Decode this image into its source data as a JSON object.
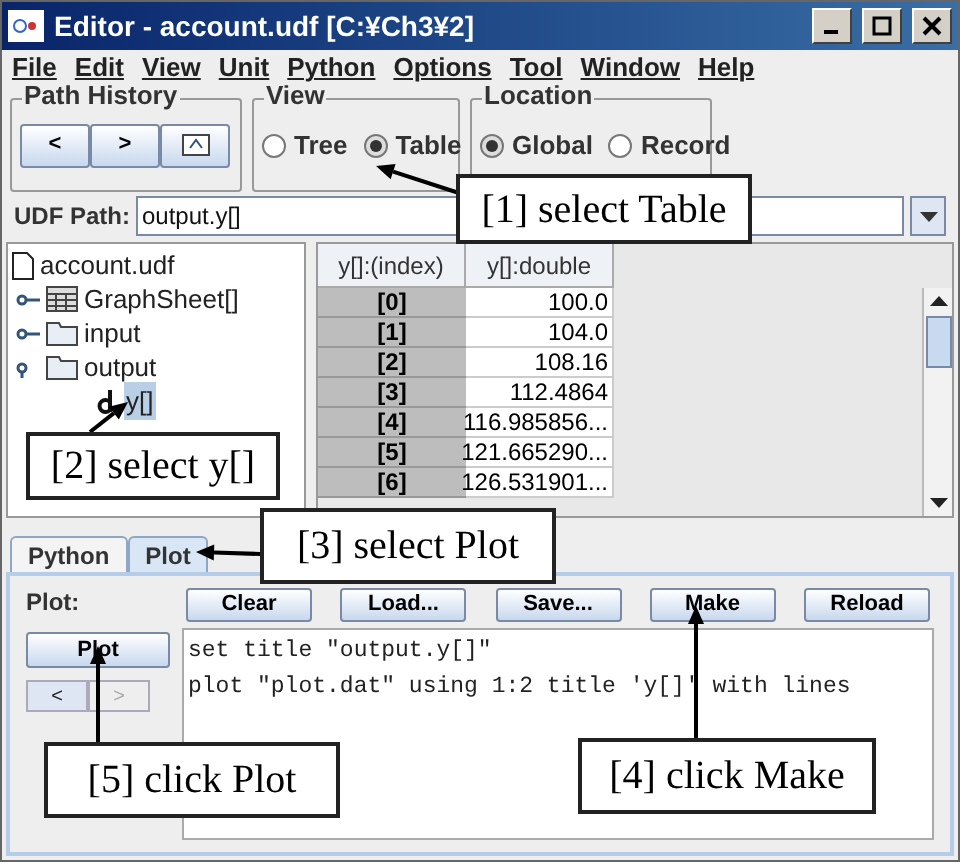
{
  "window": {
    "title": "Editor - account.udf [C:¥Ch3¥2]"
  },
  "menu": [
    "File",
    "Edit",
    "View",
    "Unit",
    "Python",
    "Options",
    "Tool",
    "Window",
    "Help"
  ],
  "path_history": {
    "title": "Path History",
    "buttons": [
      "<",
      ">"
    ]
  },
  "view": {
    "title": "View",
    "options": [
      {
        "label": "Tree",
        "selected": false
      },
      {
        "label": "Table",
        "selected": true
      }
    ]
  },
  "location": {
    "title": "Location",
    "options": [
      {
        "label": "Global",
        "selected": true
      },
      {
        "label": "Record",
        "selected": false
      }
    ]
  },
  "udf_path": {
    "label": "UDF Path:",
    "value": "output.y[]"
  },
  "tree": {
    "label": "account.udf",
    "children": [
      {
        "label": "GraphSheet[]",
        "kind": "table",
        "expanded": false
      },
      {
        "label": "input",
        "kind": "folder",
        "expanded": false
      },
      {
        "label": "output",
        "kind": "folder",
        "expanded": true,
        "children": [
          {
            "label": "y[]",
            "kind": "variable",
            "selected": true
          }
        ]
      }
    ]
  },
  "table": {
    "columns": [
      "y[]:(index)",
      "y[]:double"
    ],
    "rows": [
      [
        "[0]",
        "100.0"
      ],
      [
        "[1]",
        "104.0"
      ],
      [
        "[2]",
        "108.16"
      ],
      [
        "[3]",
        "112.4864"
      ],
      [
        "[4]",
        "116.985856..."
      ],
      [
        "[5]",
        "121.665290..."
      ],
      [
        "[6]",
        "126.531901..."
      ]
    ]
  },
  "tabs": [
    {
      "label": "Python",
      "selected": false
    },
    {
      "label": "Plot",
      "selected": true
    }
  ],
  "plot_panel": {
    "label": "Plot:",
    "plot_button": "Plot",
    "nav": [
      {
        "label": "<",
        "disabled": false
      },
      {
        "label": ">",
        "disabled": true
      }
    ],
    "buttons": [
      "Clear",
      "Load...",
      "Save...",
      "Make",
      "Reload"
    ],
    "code": [
      "set title \"output.y[]\"",
      "plot \"plot.dat\" using 1:2 title 'y[]' with lines"
    ]
  },
  "callouts": [
    "[1] select Table",
    "[2] select y[]",
    "[3] select Plot",
    "[4] click Make",
    "[5] click Plot"
  ]
}
